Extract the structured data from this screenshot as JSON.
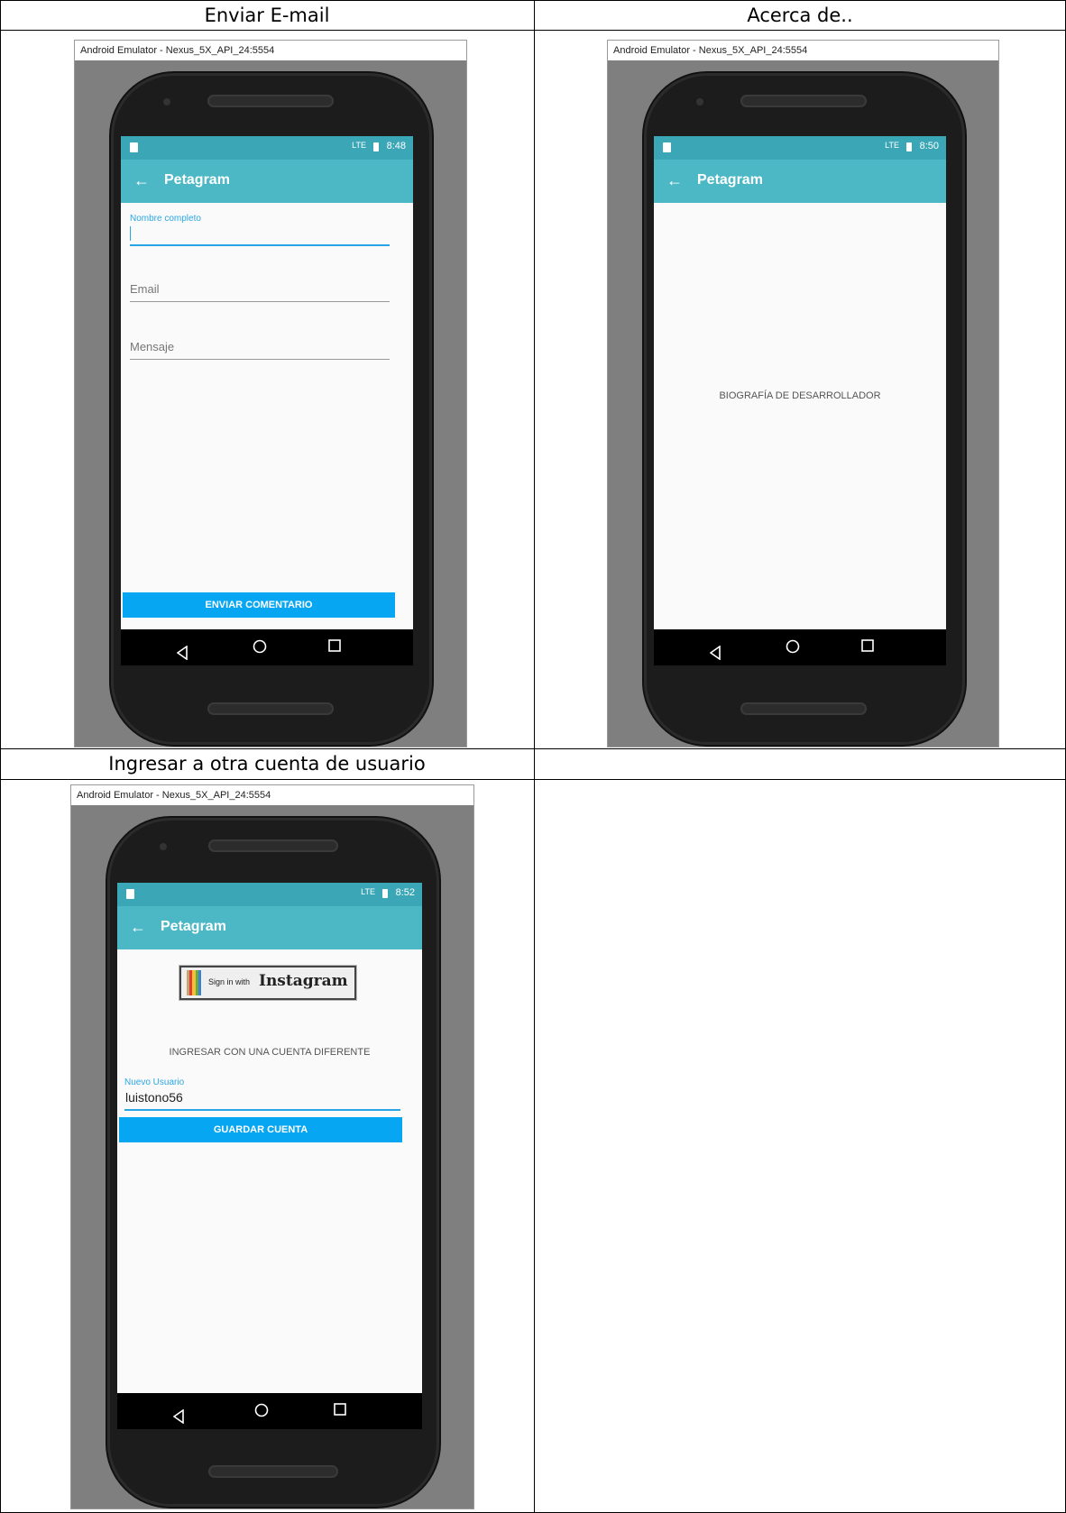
{
  "cells": {
    "email": {
      "title": "Enviar E-mail",
      "window_title": "Android Emulator - Nexus_5X_API_24:5554",
      "status_time": "8:48",
      "status_signal": "LTE",
      "app_title": "Petagram",
      "fields": [
        {
          "label": "Nombre completo"
        },
        {
          "hint": "Email"
        },
        {
          "hint": "Mensaje"
        }
      ],
      "button": "ENVIAR COMENTARIO"
    },
    "about": {
      "title": "Acerca de..",
      "window_title": "Android Emulator - Nexus_5X_API_24:5554",
      "status_time": "8:50",
      "status_signal": "LTE",
      "app_title": "Petagram",
      "body_text": "BIOGRAFÍA DE DESARROLLADOR"
    },
    "account": {
      "title": "Ingresar a otra cuenta de usuario",
      "window_title": "Android Emulator - Nexus_5X_API_24:5554",
      "status_time": "8:52",
      "status_signal": "LTE",
      "app_title": "Petagram",
      "instagram_small": "Sign in with",
      "instagram_big": "Instagram",
      "heading": "INGRESAR CON UNA CUENTA DIFERENTE",
      "field_label": "Nuevo Usuario",
      "field_value": "luistono56",
      "button": "GUARDAR CUENTA"
    }
  },
  "icons": {
    "back_arrow": "←",
    "nav_back": "nav-back-icon",
    "nav_home": "nav-home-icon",
    "nav_recent": "nav-recent-icon"
  },
  "colors": {
    "status_bar": "#3aa6b6",
    "app_bar": "#4cb8c6",
    "accent": "#29a5e5",
    "button": "#06a6f2"
  }
}
